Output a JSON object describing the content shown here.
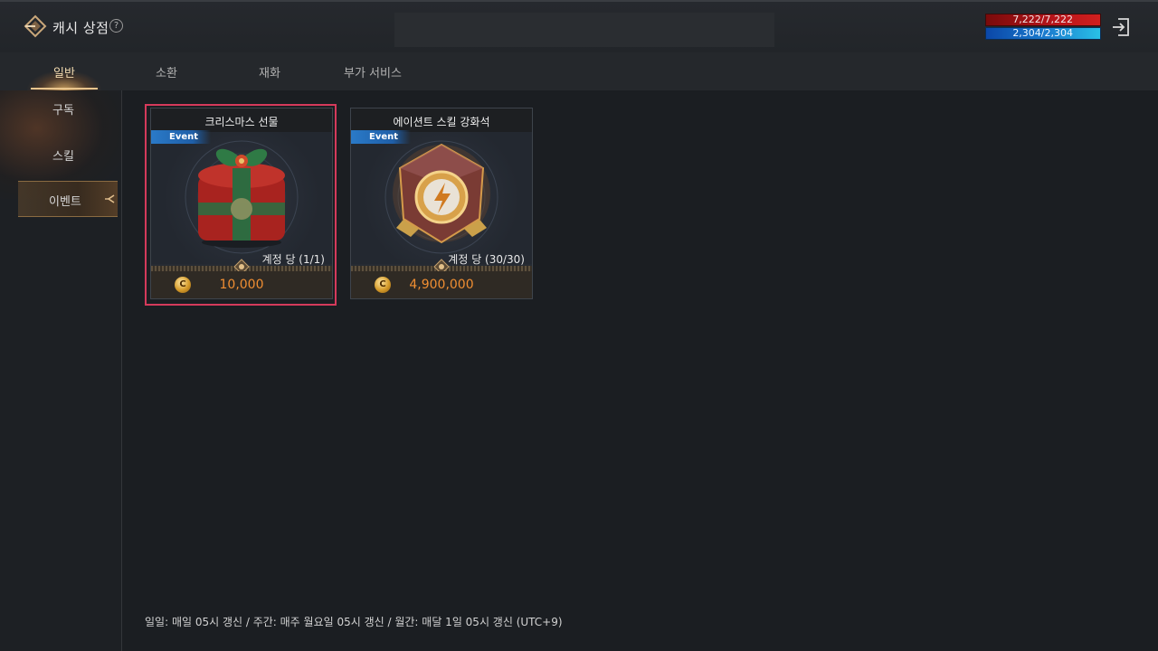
{
  "header": {
    "title": "캐시 상점",
    "help_symbol": "?",
    "hp_text": "7,222/7,222",
    "mp_text": "2,304/2,304",
    "colors": {
      "hp": "#b8141a",
      "mp": "#1c7fd0",
      "price": "#f08e32",
      "selection": "#d53a5b"
    },
    "icons": {
      "logo": "shop-logo-icon",
      "exit": "exit-icon"
    }
  },
  "tabs": [
    {
      "label": "일반",
      "active": true
    },
    {
      "label": "소환",
      "active": false
    },
    {
      "label": "재화",
      "active": false
    },
    {
      "label": "부가 서비스",
      "active": false
    }
  ],
  "sidebar": {
    "items": [
      {
        "label": "구독",
        "active": false
      },
      {
        "label": "스킬",
        "active": false
      },
      {
        "label": "이벤트",
        "active": true
      }
    ]
  },
  "products": [
    {
      "title": "크리스마스 선물",
      "badge": "Event",
      "limit": "계정 당 (1/1)",
      "price": "10,000",
      "coin_symbol": "C",
      "icon": "gift-box-icon",
      "selected": true
    },
    {
      "title": "에이션트 스킬 강화석",
      "badge": "Event",
      "limit": "계정 당 (30/30)",
      "price": "4,900,000",
      "coin_symbol": "C",
      "icon": "skill-stone-icon",
      "selected": false
    }
  ],
  "footer": {
    "note": "일일: 매일 05시 갱신 / 주간: 매주 월요일 05시 갱신 / 월간: 매달 1일 05시 갱신 (UTC+9)"
  }
}
